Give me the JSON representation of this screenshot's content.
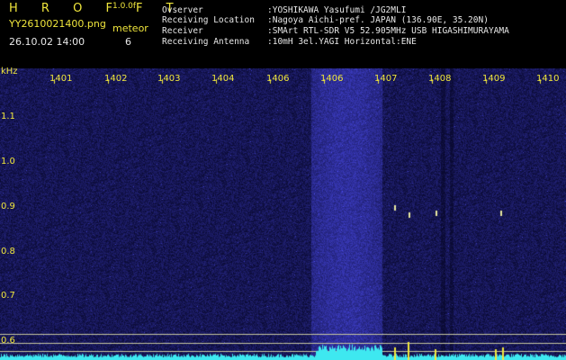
{
  "header": {
    "logo": "H R O F F T",
    "version": "1.0.0f",
    "filename": "YY2610021400.png",
    "meteor_label": "meteor",
    "datetime": "26.10.02 14:00",
    "meteor_count": "6"
  },
  "info": {
    "observer_label": "Ovserver",
    "observer_value": ":YOSHIKAWA Yasufumi /JG2MLI",
    "location_label": "Receiving Location",
    "location_value": ":Nagoya Aichi-pref. JAPAN (136.90E, 35.20N)",
    "receiver_label": "Receiver",
    "receiver_value": ":SMArt RTL-SDR V5 52.905MHz USB HIGASHIMURAYAMA",
    "antenna_label": "Receiving Antenna",
    "antenna_value": ":10mH 3el.YAGI Horizontal:ENE"
  },
  "axis": {
    "unit": "kHz",
    "x_ticks": [
      "1401",
      "1402",
      "1403",
      "1404",
      "1406",
      "1406",
      "1407",
      "1408",
      "1409",
      "1410"
    ],
    "y_ticks": [
      "1.1",
      "1.0",
      "0.9",
      "0.8",
      "0.7",
      "0.6"
    ]
  },
  "colors": {
    "header_text": "#f0e63c",
    "info_text": "#e8e8e8",
    "background": "#000000",
    "noise_dark": "#0a0a3c",
    "noise_bright": "#4a4ad8",
    "spectrum": "#3ee8f0"
  }
}
